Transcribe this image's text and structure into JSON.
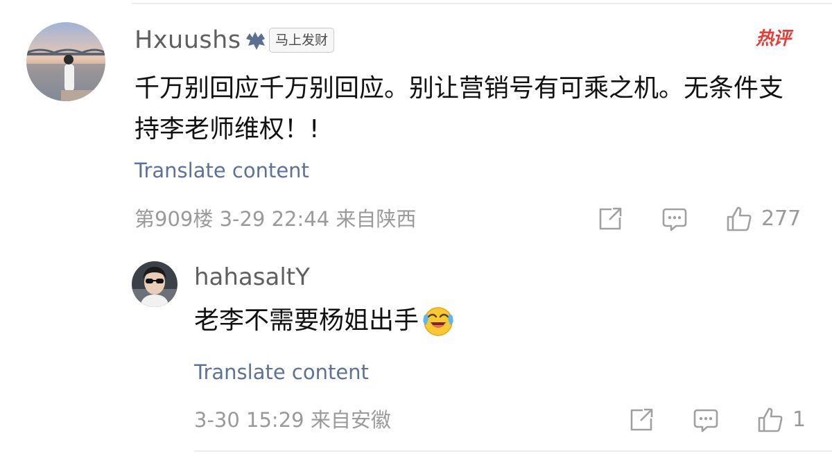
{
  "main_comment": {
    "username": "Hxuushs",
    "badge_icon": "hand-gesture-icon",
    "badge_text": "马上发财",
    "hot_tag": "热评",
    "content": "千万别回应千万别回应。别让营销号有可乘之机。无条件支持李老师维权！!",
    "translate": "Translate content",
    "meta": "第909楼  3-29 22:44  来自陕西",
    "likes": "277"
  },
  "reply": {
    "username": "hahasaltY",
    "content": "老李不需要杨姐出手",
    "emoji": "laughing-crying-icon",
    "translate": "Translate content",
    "meta": "3-30 15:29  来自安徽",
    "likes": "1"
  },
  "colors": {
    "username": "#5f5f5f",
    "text": "#111111",
    "link": "#5d7299",
    "meta": "#9a9a9a",
    "hot": "#e93c34"
  }
}
